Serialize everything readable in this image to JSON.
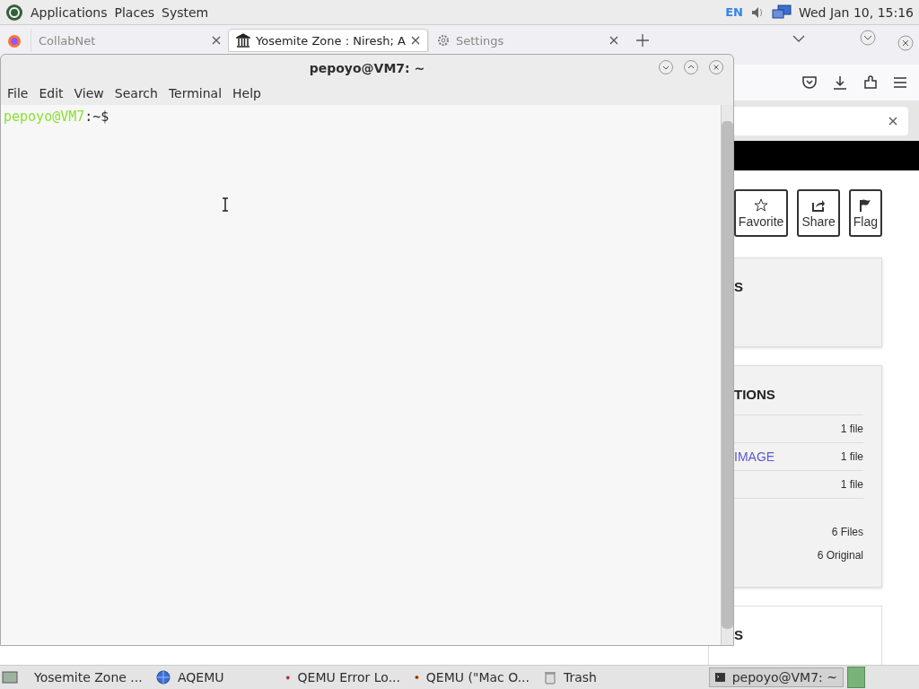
{
  "top_panel": {
    "menus": [
      "Applications",
      "Places",
      "System"
    ],
    "keyboard_layout": "EN",
    "clock": "Wed Jan 10, 15:16"
  },
  "browser": {
    "tabs": [
      {
        "label": "CollabNet",
        "selected": false
      },
      {
        "label": "Yosemite Zone : Niresh; A",
        "selected": true
      },
      {
        "label": "Settings",
        "selected": false
      }
    ],
    "page": {
      "actions": [
        {
          "label": "Favorite"
        },
        {
          "label": "Share"
        },
        {
          "label": "Flag"
        }
      ],
      "panels": [
        {
          "kind": "gray",
          "heading": "S"
        },
        {
          "kind": "gray",
          "heading": "TIONS",
          "rows": [
            {
              "count": "1 file"
            },
            {
              "label": "IMAGE",
              "count": "1 file"
            },
            {
              "count": "1 file"
            }
          ],
          "totals": [
            "6 Files",
            "6 Original"
          ]
        },
        {
          "kind": "white",
          "heading": "S"
        }
      ]
    }
  },
  "terminal": {
    "title": "pepoyo@VM7: ~",
    "menus": [
      "File",
      "Edit",
      "View",
      "Search",
      "Terminal",
      "Help"
    ],
    "prompt": {
      "user_host": "pepoyo@VM7",
      "separator": ":",
      "path": "~",
      "symbol": "$"
    }
  },
  "taskbar": {
    "items": [
      {
        "label": "Yosemite Zone ...",
        "selected": false
      },
      {
        "label": "AQEMU",
        "selected": false
      },
      {
        "label": "QEMU Error Lo...",
        "selected": false
      },
      {
        "label": "QEMU (\"Mac O...",
        "selected": false
      },
      {
        "label": "Trash",
        "selected": false
      },
      {
        "label": "pepoyo@VM7: ~",
        "selected": true
      }
    ]
  }
}
